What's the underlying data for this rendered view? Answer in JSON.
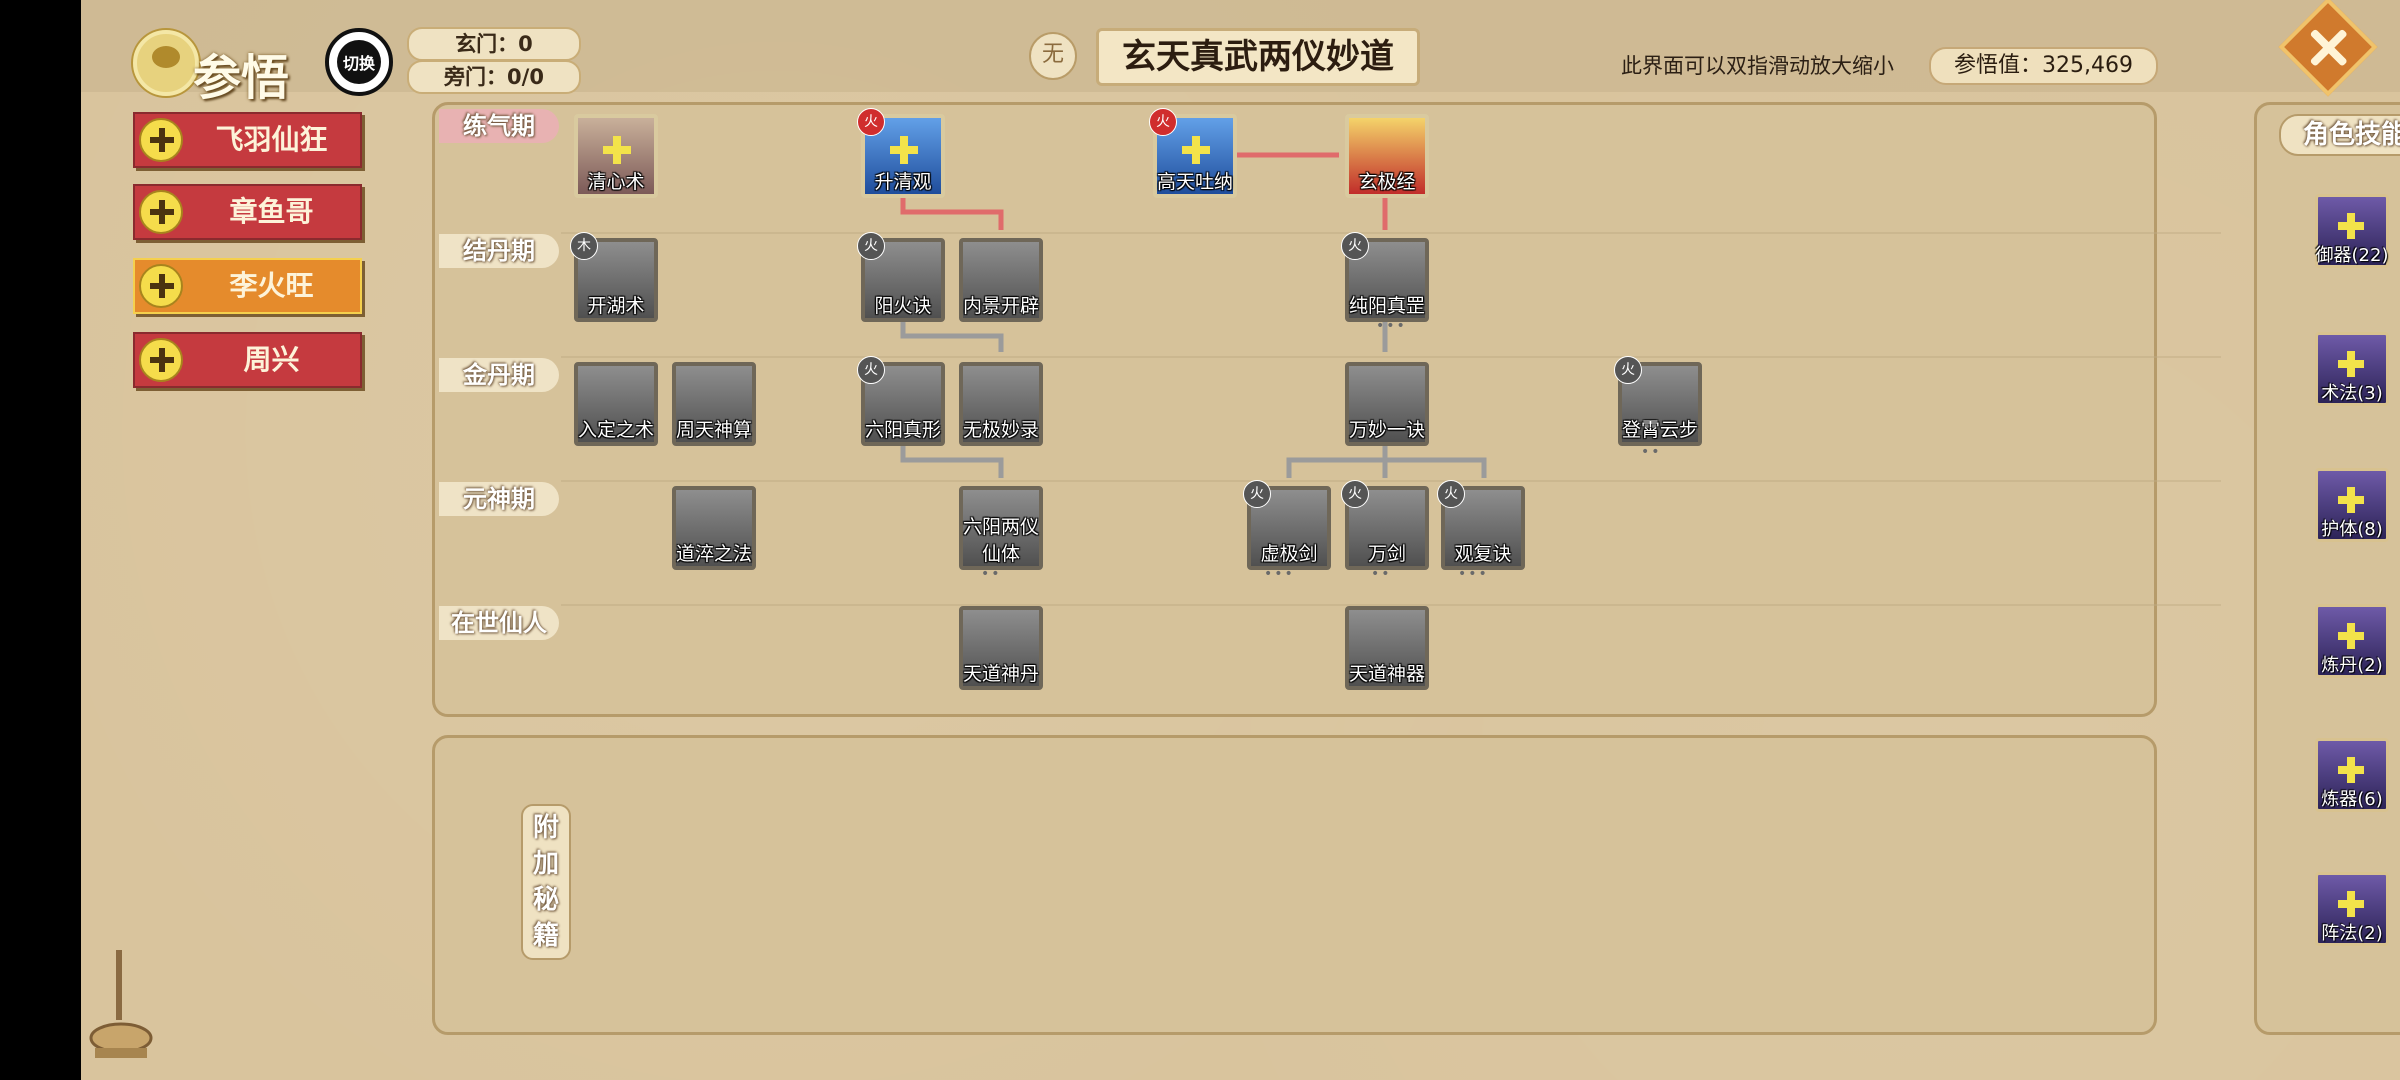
{
  "header": {
    "title": "参悟",
    "switch_label": "切换",
    "counter_xuan": "玄门：0",
    "counter_pang": "旁门：0/0",
    "badge": "无",
    "main_title": "玄天真武两仪妙道",
    "hint": "此界面可以双指滑动放大缩小",
    "score": "参悟值：325,469"
  },
  "characters": [
    {
      "name": "飞羽仙狂",
      "active": false
    },
    {
      "name": "章鱼哥",
      "active": false
    },
    {
      "name": "李火旺",
      "active": true
    },
    {
      "name": "周兴",
      "active": false
    }
  ],
  "tiers": [
    "练气期",
    "结丹期",
    "金丹期",
    "元神期",
    "在世仙人"
  ],
  "nodes": {
    "qingxin": "清心术",
    "shengqing": "升清观",
    "gaotian": "高天吐纳",
    "xuanji": "玄极经",
    "kaihu": "开湖术",
    "yanghuo": "阳火诀",
    "neijing": "内景开辟",
    "chunyang": "纯阳真罡",
    "ruding": "入定之术",
    "zhoutian": "周天神算",
    "liuyang": "六阳真形",
    "wuji": "无极妙录",
    "wanmiao": "万妙一诀",
    "dengxiao": "登霄云步",
    "daocui": "道淬之法",
    "liangyi": "六阳两仪仙体",
    "xuji": "虚极剑",
    "wanjian": "万剑",
    "guanfu": "观复诀",
    "tiandao_dan": "天道神丹",
    "tiandao_qi": "天道神器"
  },
  "fire_badge": "火",
  "wood_badge": "木",
  "extra": "附加秘籍",
  "role_skills": {
    "title": "角色技能",
    "items": [
      "御器(22)",
      "术法(3)",
      "护体(8)",
      "炼丹(2)",
      "炼器(6)",
      "阵法(2)"
    ]
  }
}
